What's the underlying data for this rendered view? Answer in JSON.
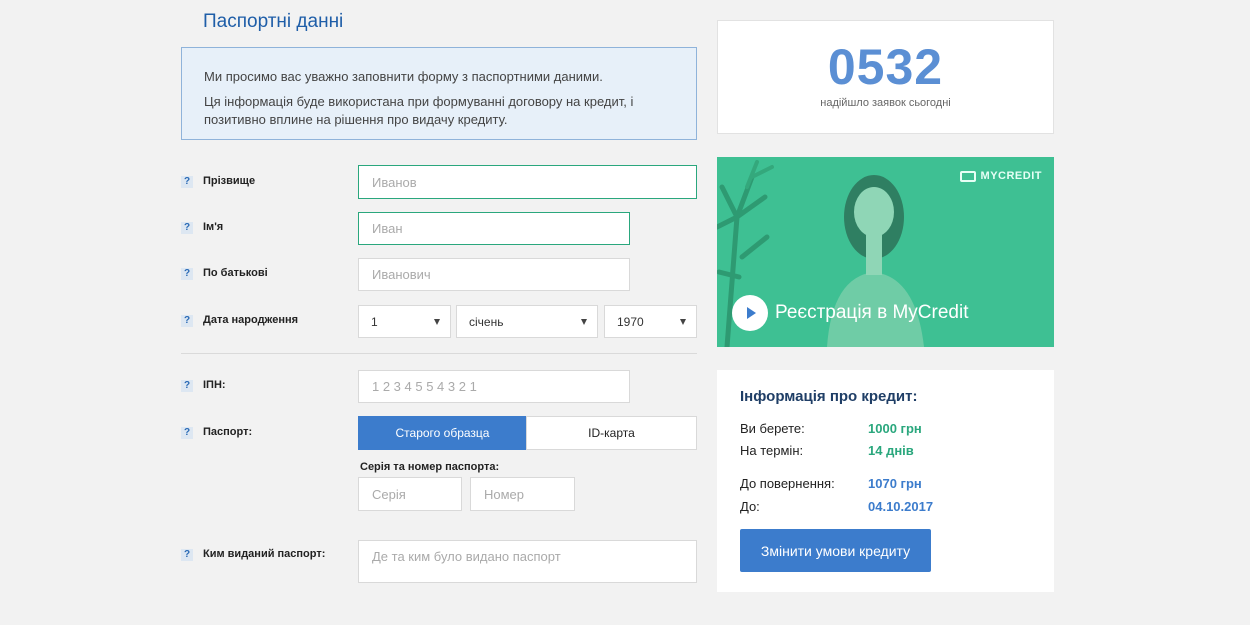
{
  "page": {
    "title": "Паспортні данні"
  },
  "notice": {
    "line1": "Ми просимо вас уважно заповнити форму з паспортними даними.",
    "line2": "Ця інформація буде використана при формуванні договору на кредит, і позитивно вплине на рішення про видачу кредиту."
  },
  "form": {
    "help_glyph": "?",
    "surname": {
      "label": "Прізвище",
      "placeholder": "Иванов"
    },
    "name": {
      "label": "Ім'я",
      "placeholder": "Иван"
    },
    "patronymic": {
      "label": "По батькові",
      "placeholder": "Иванович"
    },
    "birthdate": {
      "label": "Дата народження",
      "day": "1",
      "month": "січень",
      "year": "1970"
    },
    "ipn": {
      "label": "ІПН:",
      "placeholder": "1 2 3 4 5 5 4 3 2 1"
    },
    "passport": {
      "label": "Паспорт:",
      "option_old": "Старого образца",
      "option_id": "ID-карта",
      "selected": "Старого образца",
      "series_number_label": "Серія та номер паспорта:",
      "series_placeholder": "Серія",
      "number_placeholder": "Номер"
    },
    "issued_by": {
      "label": "Ким виданий паспорт:",
      "placeholder": "Де та ким було видано паспорт"
    }
  },
  "counter": {
    "value": "0532",
    "caption": "надійшло заявок сьогодні"
  },
  "video": {
    "brand": "MYCREDIT",
    "title": "Реєстрація в MyCredit"
  },
  "credit": {
    "title": "Інформація про кредит:",
    "take_label": "Ви берете:",
    "take_value": "1000 грн",
    "term_label": "На термін:",
    "term_value": "14 днів",
    "return_label": "До повернення:",
    "return_value": "1070 грн",
    "until_label": "До:",
    "until_value": "04.10.2017",
    "change_button": "Змінити умови кредиту"
  },
  "colors": {
    "primary": "#3c7ccc",
    "accent": "#2aa77d",
    "video_bg": "#3ec093"
  }
}
